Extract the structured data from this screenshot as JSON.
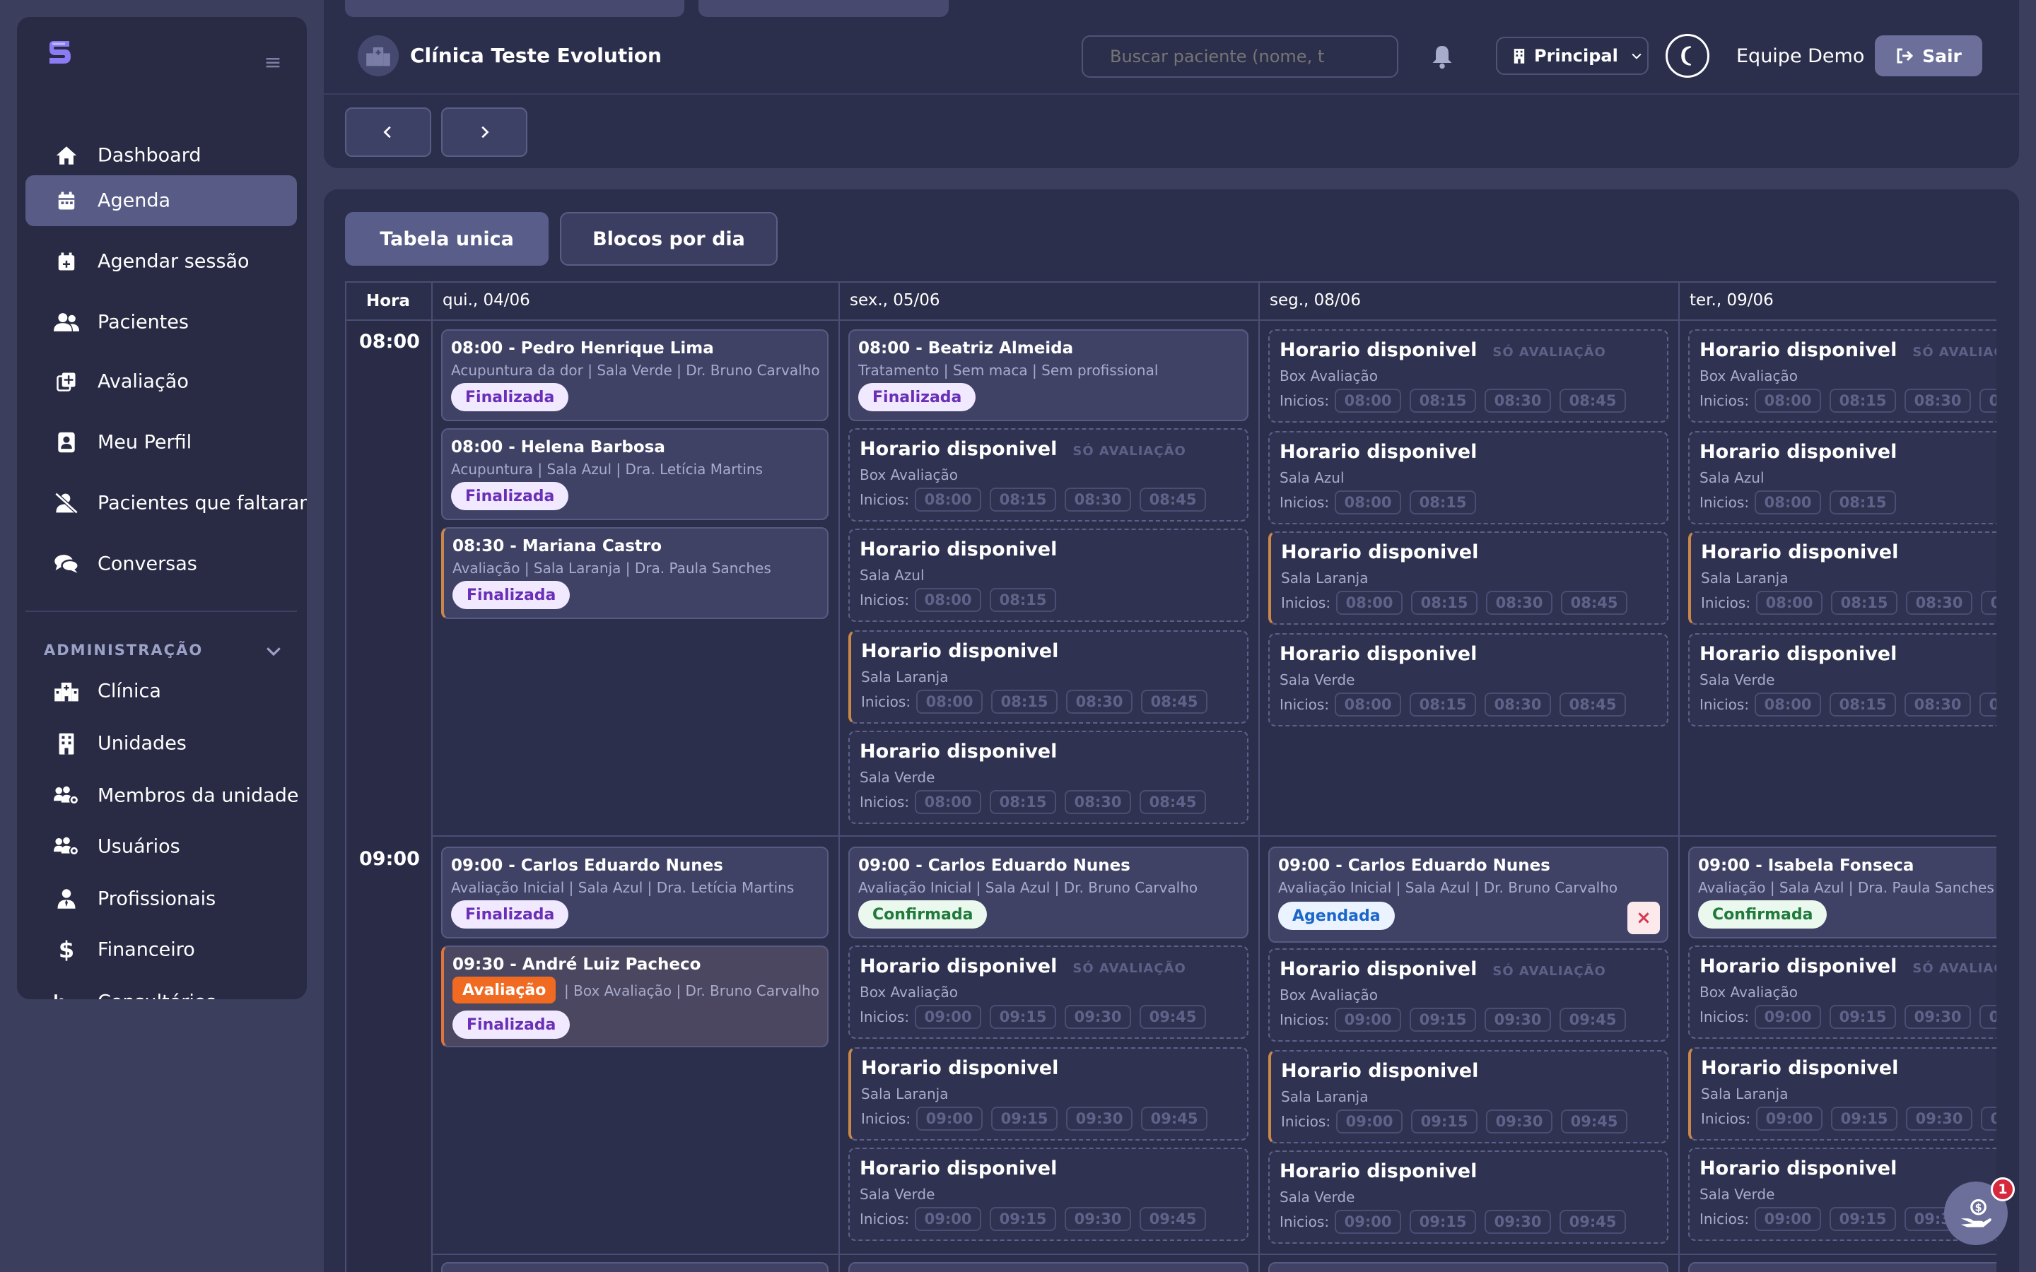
{
  "sidebar": {
    "items": [
      {
        "label": "Dashboard",
        "icon": "home-icon"
      },
      {
        "label": "Agenda",
        "icon": "calendar-icon",
        "active": true
      },
      {
        "label": "Agendar sessão",
        "icon": "calendar-plus-icon"
      },
      {
        "label": "Pacientes",
        "icon": "users-icon"
      },
      {
        "label": "Avaliação",
        "icon": "clipboard-plus-icon"
      },
      {
        "label": "Meu Perfil",
        "icon": "id-badge-icon"
      },
      {
        "label": "Pacientes que faltaram",
        "icon": "user-slash-icon"
      },
      {
        "label": "Conversas",
        "icon": "chat-icon"
      }
    ],
    "admin_section": "ADMINISTRAÇÃO",
    "admin_items": [
      {
        "label": "Clínica",
        "icon": "hospital-icon"
      },
      {
        "label": "Unidades",
        "icon": "building-icon"
      },
      {
        "label": "Membros da unidade",
        "icon": "people-gear-icon"
      },
      {
        "label": "Usuários",
        "icon": "users-cog-icon"
      },
      {
        "label": "Profissionais",
        "icon": "user-tie-icon"
      },
      {
        "label": "Financeiro",
        "icon": "dollar-icon"
      },
      {
        "label": "Consultórios",
        "icon": "bed-icon"
      }
    ]
  },
  "header": {
    "clinic_name": "Clínica Teste Evolution",
    "search_placeholder": "Buscar paciente (nome, t",
    "unit_label": "Principal",
    "user_name": "Equipe Demo",
    "logout_label": "Sair"
  },
  "tabs": {
    "single": "Tabela unica",
    "blocks": "Blocos por dia"
  },
  "grid": {
    "hour_header": "Hora",
    "days": [
      "qui., 04/06",
      "sex., 05/06",
      "seg., 08/06",
      "ter., 09/06"
    ],
    "hours": [
      "08:00",
      "09:00"
    ],
    "free_title": "Horario disponivel",
    "only_eval": "SÓ AVALIAÇÃO",
    "starts_label": "Inicios:",
    "cancel_symbol": "×"
  },
  "appointments": {
    "d1_8_1": {
      "title": "08:00 - Pedro Henrique Lima",
      "sub": "Acupuntura da dor | Sala Verde | Dr. Bruno Carvalho",
      "status": "Finalizada"
    },
    "d1_8_2": {
      "title": "08:00 - Helena Barbosa",
      "sub": "Acupuntura | Sala Azul | Dra. Letícia Martins",
      "status": "Finalizada"
    },
    "d1_8_3": {
      "title": "08:30 - Mariana Castro",
      "sub": "Avaliação | Sala Laranja | Dra. Paula Sanches",
      "status": "Finalizada"
    },
    "d2_8_1": {
      "title": "08:00 - Beatriz Almeida",
      "sub": "Tratamento | Sem maca | Sem profissional",
      "status": "Finalizada"
    },
    "d1_9_1": {
      "title": "09:00 - Carlos Eduardo Nunes",
      "sub": "Avaliação Inicial | Sala Azul | Dra. Letícia Martins",
      "status": "Finalizada"
    },
    "d1_9_2": {
      "title": "09:30 - André Luiz Pacheco",
      "tag": "Avaliação",
      "sub": "| Box Avaliação | Dr. Bruno Carvalho",
      "status": "Finalizada"
    },
    "d2_9_1": {
      "title": "09:00 - Carlos Eduardo Nunes",
      "sub": "Avaliação Inicial | Sala Azul | Dr. Bruno Carvalho",
      "status": "Confirmada"
    },
    "d3_9_1": {
      "title": "09:00 - Carlos Eduardo Nunes",
      "sub": "Avaliação Inicial | Sala Azul | Dr. Bruno Carvalho",
      "status": "Agendada"
    },
    "d4_9_1": {
      "title": "09:00 - Isabela Fonseca",
      "sub": "Avaliação | Sala Azul | Dra. Paula Sanches",
      "status": "Confirmada"
    }
  },
  "rooms": {
    "box": "Box Avaliação",
    "azul": "Sala Azul",
    "laranja": "Sala Laranja",
    "verde": "Sala Verde"
  },
  "slots8": [
    "08:00",
    "08:15",
    "08:30",
    "08:45"
  ],
  "slots9": [
    "09:00",
    "09:15",
    "09:30",
    "09:45"
  ],
  "notification_count": "1",
  "colors": {
    "accent": "#575b86",
    "final": "#6a2fb7",
    "confirmed": "#1f7a3c",
    "scheduled": "#1b66c9",
    "evaluation": "#f06a22"
  }
}
